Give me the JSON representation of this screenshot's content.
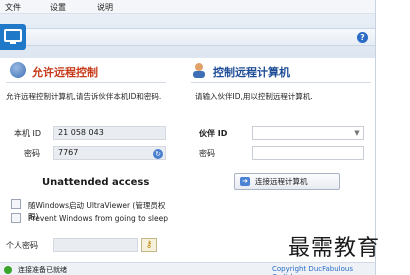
{
  "menu": {
    "file": "文件",
    "settings": "设置",
    "help": "说明"
  },
  "help_glyph": "?",
  "allow_section": {
    "title": "允许远程控制",
    "description": "允许远程控制计算机,请告诉伙伴本机ID和密码.",
    "id_label": "本机 ID",
    "id_value": "21 058 043",
    "password_label": "密码",
    "password_value": "7767",
    "unattended_title": "Unattended access",
    "checkbox_start_with_windows": "随Windows启动 UltraViewer (管理员权限)",
    "checkbox_prevent_sleep": "Prevent Windows from going to sleep",
    "personal_password_label": "个人密码",
    "personal_password_value": ""
  },
  "control_section": {
    "title": "控制远程计算机",
    "description": "请输入伙伴ID,用以控制远程计算机.",
    "partner_id_label": "伙伴 ID",
    "partner_id_value": "",
    "password_label": "密码",
    "password_value": "",
    "connect_button": "连接远程计算机"
  },
  "status": {
    "text": "连接准备已就绪",
    "copyright": "Copyright DucFabulous Co.ltd"
  },
  "watermark": "最需教育",
  "colors": {
    "accent": "#1f78c8",
    "title_red": "#c63a1a",
    "title_blue": "#1f4e97",
    "status_green": "#3aa52e"
  }
}
